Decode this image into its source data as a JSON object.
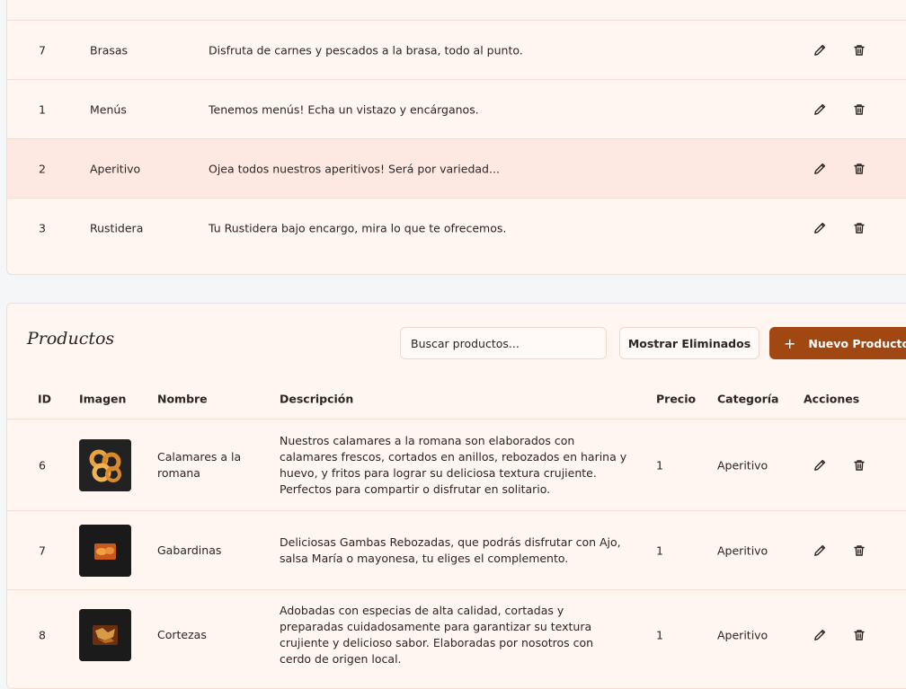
{
  "categories": {
    "rows": [
      {
        "id": "7",
        "name": "Brasas",
        "description": "Disfruta de carnes y pescados a la brasa, todo al punto."
      },
      {
        "id": "1",
        "name": "Menús",
        "description": "Tenemos menús! Echa un vistazo y encárganos."
      },
      {
        "id": "2",
        "name": "Aperitivo",
        "description": "Ojea todos nuestros aperitivos! Será por variedad..."
      },
      {
        "id": "3",
        "name": "Rustidera",
        "description": "Tu Rustidera bajo encargo, mira lo que te ofrecemos."
      }
    ]
  },
  "products": {
    "title": "Productos",
    "search_placeholder": "Buscar productos...",
    "show_deleted_label": "Mostrar Eliminados",
    "new_product_label": "Nuevo Producto",
    "new_product_icon": "plus-icon",
    "headers": {
      "id": "ID",
      "image": "Imagen",
      "name": "Nombre",
      "description": "Descripción",
      "price": "Precio",
      "category": "Categoría",
      "actions": "Acciones"
    },
    "rows": [
      {
        "id": "6",
        "image_icon": "calamares-photo",
        "name_line1": "Calamares a la",
        "name_line2": "romana",
        "description_lines": [
          "Nuestros calamares a la romana son elaborados con",
          "calamares frescos, cortados en anillos, rebozados en harina y",
          "huevo, y fritos para lograr su deliciosa textura crujiente.",
          "Perfectos para compartir o disfrutar en solitario."
        ],
        "price": "1",
        "category": "Aperitivo"
      },
      {
        "id": "7",
        "image_icon": "gambas-photo",
        "name_line1": "Gabardinas",
        "name_line2": "",
        "description_lines": [
          "Deliciosas Gambas Rebozadas, que podrás disfrutar con Ajo,",
          "salsa María o mayonesa, tu eliges el complemento."
        ],
        "price": "1",
        "category": "Aperitivo"
      },
      {
        "id": "8",
        "image_icon": "cortezas-photo",
        "name_line1": "Cortezas",
        "name_line2": "",
        "description_lines": [
          "Adobadas con especias de alta calidad, cortadas y",
          "preparadas cuidadosamente para garantizar su textura",
          "crujiente y delicioso sabor. Elaboradas por nosotros con",
          "cerdo de origen local."
        ],
        "price": "1",
        "category": "Aperitivo"
      }
    ]
  },
  "icons": {
    "edit": "pencil-icon",
    "delete": "trash-icon"
  },
  "colors": {
    "primary": "#a04712",
    "row_highlight": "#fde9e1",
    "card_bg": "#fff6f2"
  }
}
